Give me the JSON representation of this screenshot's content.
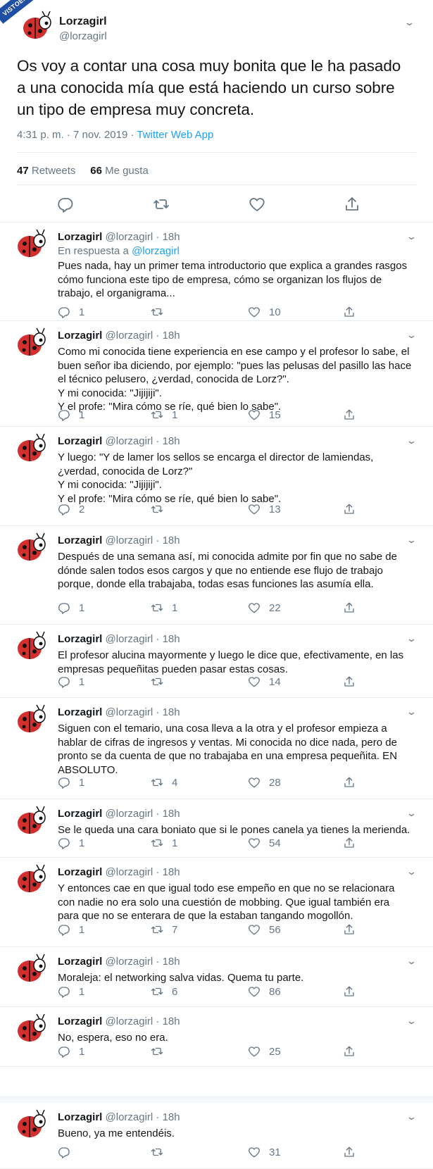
{
  "watermark": "VISTOENLASREDES",
  "main_tweet": {
    "name": "Lorzagirl",
    "handle": "@lorzagirl",
    "text": "Os voy a contar una cosa muy bonita que le ha pasado a una conocida mía que está haciendo un curso sobre un tipo de empresa muy concreta.",
    "time": "4:31 p. m. · 7 nov. 2019 · ",
    "source": "Twitter Web App",
    "retweets_count": "47",
    "retweets_label": " Retweets",
    "likes_count": "66",
    "likes_label": " Me gusta"
  },
  "replying_prefix": "En respuesta a ",
  "replying_to": "@lorzagirl",
  "icons": {
    "reply": "reply-icon",
    "retweet": "retweet-icon",
    "like": "heart-icon",
    "share": "share-icon",
    "more": "chevron-down-icon"
  },
  "accent": "#1da1f2",
  "tweets": [
    {
      "name": "Lorzagirl",
      "meta": "@lorzagirl · 18h",
      "text": "Pues nada, hay un primer tema introductorio que explica a grandes rasgos cómo funciona este tipo de empresa, cómo se organizan los flujos de trabajo, el organigrama...",
      "replies": "1",
      "retweets": "",
      "likes": "10"
    },
    {
      "name": "Lorzagirl",
      "meta": "@lorzagirl · 18h",
      "text": "Como mi conocida tiene experiencia en ese campo y el profesor lo sabe, el buen señor iba diciendo, por ejemplo: \"pues las pelusas del pasillo las hace el técnico pelusero, ¿verdad, conocida de Lorz?\".\nY mi conocida: \"Jijijiji\".\nY el profe: \"Mira cómo se ríe, qué bien lo sabe\".",
      "replies": "1",
      "retweets": "1",
      "likes": "15"
    },
    {
      "name": "Lorzagirl",
      "meta": "@lorzagirl · 18h",
      "text": "Y luego: \"Y de lamer los sellos se encarga el director de lamiendas, ¿verdad, conocida de Lorz?\"\nY mi conocida: \"Jijijiji\".\nY el profe: \"Mira cómo se ríe, qué bien lo sabe\".",
      "replies": "2",
      "retweets": "",
      "likes": "13"
    },
    {
      "name": "Lorzagirl",
      "meta": "@lorzagirl · 18h",
      "text": "Después de una semana así, mi conocida admite por fin que no sabe de dónde salen todos esos cargos y que no entiende ese flujo de trabajo porque, donde ella trabajaba, todas esas funciones las asumía ella.",
      "replies": "1",
      "retweets": "1",
      "likes": "22"
    },
    {
      "name": "Lorzagirl",
      "meta": "@lorzagirl · 18h",
      "text": "El profesor alucina mayormente y luego le dice que, efectivamente, en las empresas pequeñitas pueden pasar estas cosas.",
      "replies": "1",
      "retweets": "",
      "likes": "14"
    },
    {
      "name": "Lorzagirl",
      "meta": "@lorzagirl · 18h",
      "text": "Siguen con el temario, una cosa lleva a la otra y el profesor empieza a hablar de cifras de ingresos y ventas. Mi conocida no dice nada, pero de pronto se da cuenta de que no trabajaba en una empresa pequeñita. EN ABSOLUTO.",
      "replies": "1",
      "retweets": "4",
      "likes": "28"
    },
    {
      "name": "Lorzagirl",
      "meta": "@lorzagirl · 18h",
      "text": "Se le queda una cara boniato que si le pones canela ya tienes la merienda.",
      "replies": "1",
      "retweets": "1",
      "likes": "54"
    },
    {
      "name": "Lorzagirl",
      "meta": "@lorzagirl · 18h",
      "text": "Y entonces cae en que igual todo ese empeño en que no se relacionara con nadie no era solo una cuestión de mobbing. Que igual también era para que no se enterara de que la estaban tangando mogollón.",
      "replies": "1",
      "retweets": "7",
      "likes": "56"
    },
    {
      "name": "Lorzagirl",
      "meta": "@lorzagirl · 18h",
      "text": "Moraleja: el networking salva vidas. Quema tu parte.",
      "replies": "1",
      "retweets": "6",
      "likes": "86"
    },
    {
      "name": "Lorzagirl",
      "meta": "@lorzagirl · 18h",
      "text": "No, espera, eso no era.",
      "replies": "1",
      "retweets": "",
      "likes": "25"
    },
    {
      "name": "Lorzagirl",
      "meta": "@lorzagirl · 18h",
      "text": "Bueno, ya me entendéis.",
      "replies": "",
      "retweets": "",
      "likes": "31"
    }
  ]
}
